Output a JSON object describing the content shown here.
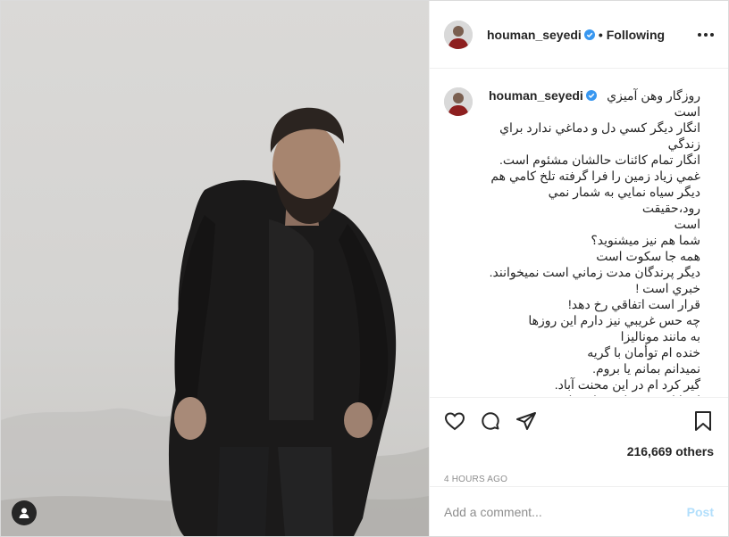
{
  "header": {
    "username": "houman_seyedi",
    "separator": "•",
    "follow_status": "Following"
  },
  "caption": {
    "username": "houman_seyedi",
    "first_line": "روزگار وهن آميزي",
    "lines": [
      "است",
      "انگار ديگر كسي دل و دماغي ندارد براي",
      "زندگي",
      "انگار تمام كائنات حالشان مشئوم است.",
      "غمي زياد زمين را فرا گرفته تلخ كامي هم",
      "ديگر سياه نمايي به شمار نمي رود،حقيقت",
      "است",
      "شما هم نيز ميشنويد؟",
      "همه جا سكوت است",
      "ديگر پرندگان مدت زماني است نميخوانند.",
      "خبري است !",
      "قرار است اتفاقي رخ دهد!",
      "چه حس غريبي نيز دارم اين روزها",
      "به مانند موناليزا",
      "خنده ام توأمان با گريه",
      "نميدانم بمانم يا بروم.",
      "گير كرد ام در اين محنت آباد.",
      "اچرا اين زمستان سياه تمام نميشود!"
    ]
  },
  "actions": {
    "likes": "216,669 others",
    "timestamp": "4 HOURS AGO"
  },
  "comment_box": {
    "placeholder": "Add a comment...",
    "post_label": "Post"
  },
  "icons": {
    "verified": "verified-badge-icon",
    "more": "more-options-icon",
    "like": "heart-icon",
    "comment": "comment-icon",
    "share": "paper-plane-icon",
    "save": "bookmark-icon",
    "user_tag": "user-tag-icon"
  },
  "colors": {
    "verified": "#3897f0",
    "post_disabled": "#b2dffc",
    "muted": "#8e8e8e",
    "text": "#262626"
  }
}
